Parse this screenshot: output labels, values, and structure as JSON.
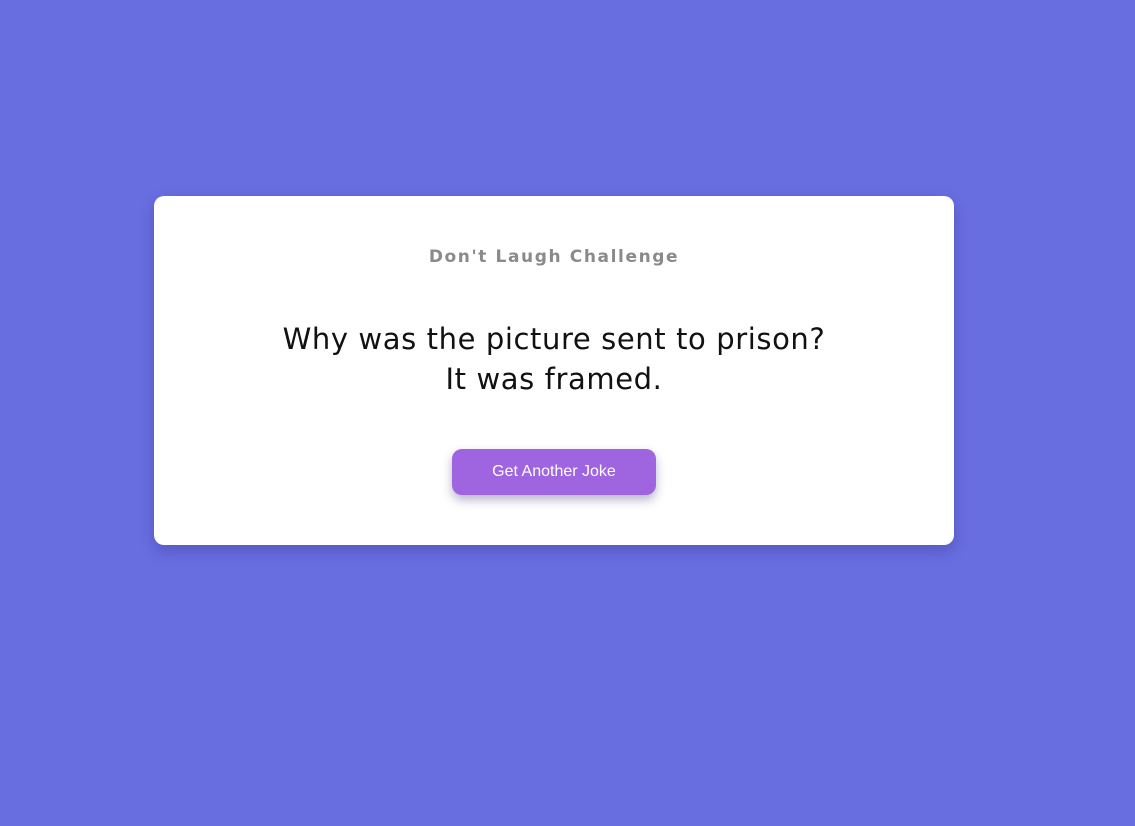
{
  "theme": {
    "background": "#686de0",
    "card": "#ffffff",
    "button": "#9f64e0",
    "title_color": "#8a8a8a"
  },
  "card": {
    "title": "Don't Laugh Challenge",
    "joke": "Why was the picture sent to prison? It was framed.",
    "button_label": "Get Another Joke"
  }
}
